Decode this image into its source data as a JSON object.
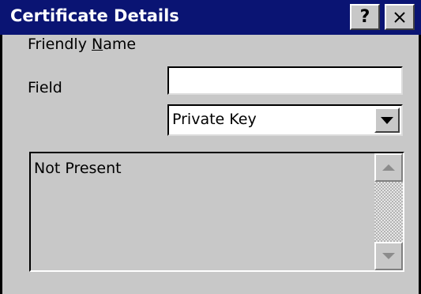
{
  "window": {
    "title": "Certificate Details",
    "help_label": "?",
    "close_icon": "close-icon"
  },
  "form": {
    "friendly_name_label_pre": "Friendly ",
    "friendly_name_label_accel": "N",
    "friendly_name_label_post": "ame",
    "friendly_name_value": "",
    "field_label": "Field",
    "field_value": "Private Key"
  },
  "details": {
    "text": "Not Present"
  },
  "colors": {
    "titlebar": "#0a1473",
    "face": "#c8c8c8",
    "title_text": "#ffffff"
  }
}
